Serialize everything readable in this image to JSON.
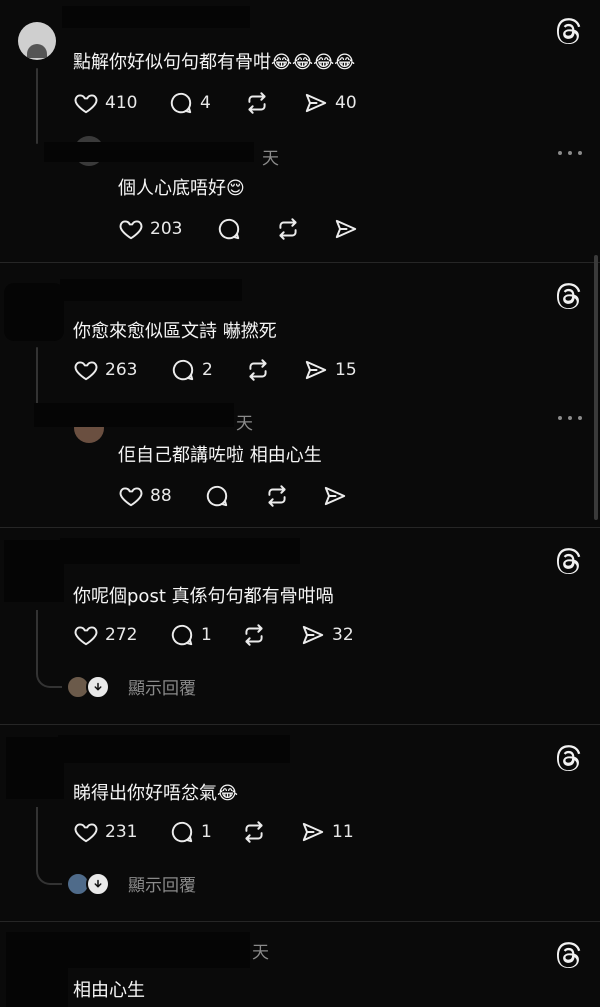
{
  "threads": [
    {
      "text": "點解你好似句句都有骨咁😂😂😂😂",
      "likes": "410",
      "replies": "4",
      "shares": "40",
      "reply": {
        "text": "個人心底唔好😌",
        "likes": "203",
        "meta": "天"
      }
    },
    {
      "text": "你愈來愈似區文詩 嚇撚死",
      "likes": "263",
      "replies": "2",
      "shares": "15",
      "reply": {
        "text": "佢自己都講咗啦 相由心生",
        "likes": "88",
        "meta": "天"
      }
    },
    {
      "text": "你呢個post 真係句句都有骨咁喎",
      "likes": "272",
      "replies": "1",
      "shares": "32",
      "show_replies": "顯示回覆"
    },
    {
      "text": "睇得出你好唔忿氣😂",
      "likes": "231",
      "replies": "1",
      "shares": "11",
      "show_replies": "顯示回覆"
    },
    {
      "text": "相由心生",
      "meta": "天"
    }
  ],
  "icons": {
    "like": "heart-icon",
    "comment": "comment-icon",
    "repost": "repost-icon",
    "share": "share-icon",
    "brand": "threads-logo-icon",
    "menu": "more-icon"
  }
}
